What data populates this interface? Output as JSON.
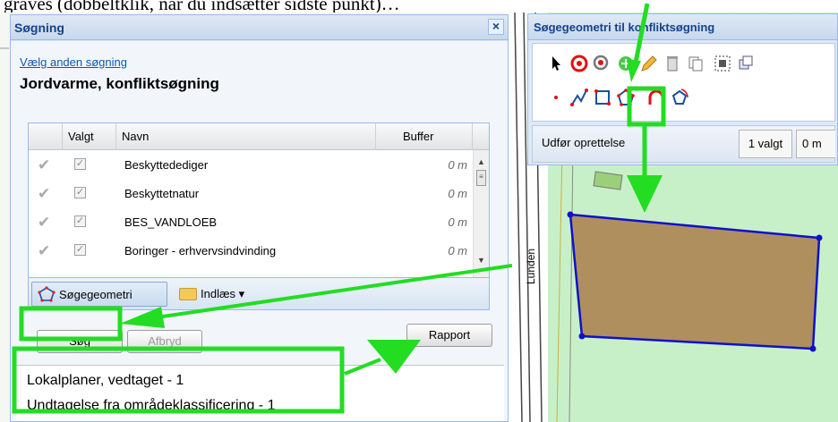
{
  "caption": "graves (dobbeltklik, når du indsætter sidste punkt)…",
  "search_panel": {
    "title": "Søgning",
    "other_search_link": "Vælg anden søgning",
    "search_name": "Jordvarme, konfliktsøgning",
    "columns": {
      "selected": "Valgt",
      "name": "Navn",
      "buffer": "Buffer"
    },
    "rows": [
      {
        "name": "Beskyttedediger",
        "buffer": "0 m"
      },
      {
        "name": "Beskyttetnatur",
        "buffer": "0 m"
      },
      {
        "name": "BES_VANDLOEB",
        "buffer": "0 m"
      },
      {
        "name": "Boringer - erhvervsindvinding",
        "buffer": "0 m"
      }
    ],
    "geometry_tab": "Søgegeometri",
    "import_button": "Indlæs ▾",
    "search_button": "Søg",
    "cancel_button": "Afbryd",
    "report_button": "Rapport",
    "results": [
      "Lokalplaner, vedtaget - 1",
      "Undtagelse fra områdeklassificering - 1"
    ]
  },
  "geometry_window": {
    "title": "Søgegeometri til konfliktsøgning",
    "execute_label": "Udfør oprettelse",
    "selected_count": "1 valgt",
    "area_value": "0 m"
  },
  "map": {
    "street_label": "Lunden"
  },
  "colors": {
    "highlight_green": "#22dd22",
    "polygon_fill": "#b08f5f",
    "polygon_stroke": "#1010cc",
    "header_text": "#15428b"
  }
}
